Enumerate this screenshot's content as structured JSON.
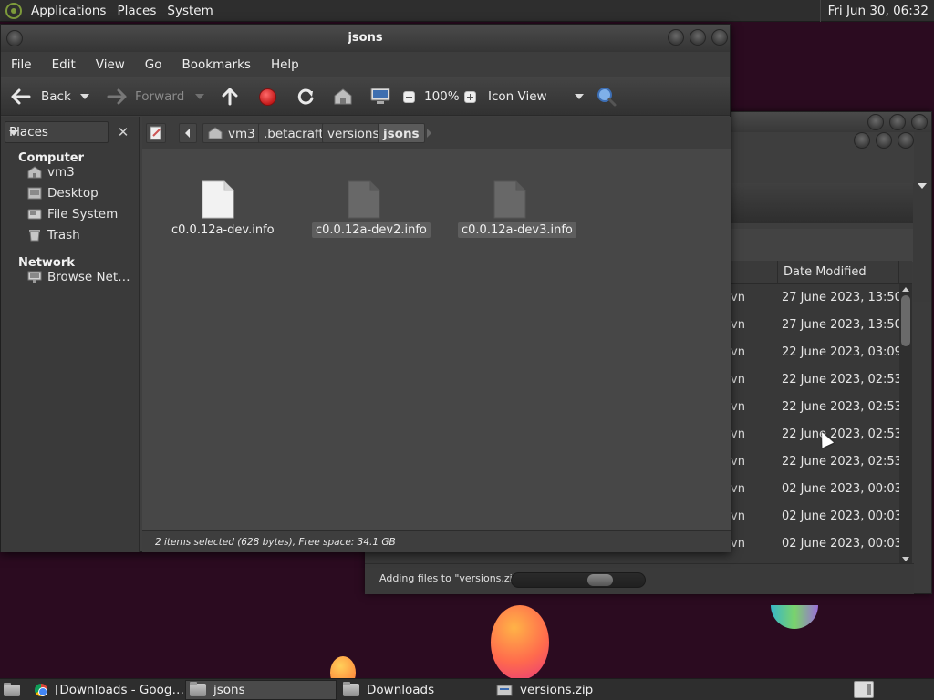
{
  "top_panel": {
    "menus": [
      "Applications",
      "Places",
      "System"
    ],
    "clock": "Fri Jun 30, 06:32"
  },
  "window": {
    "title": "jsons",
    "menus": [
      "File",
      "Edit",
      "View",
      "Go",
      "Bookmarks",
      "Help"
    ],
    "toolbar": {
      "back": "Back",
      "forward": "Forward",
      "zoom": "100%",
      "view_mode": "Icon View"
    },
    "sidebar": {
      "header": "Places",
      "sections": [
        {
          "title": "Computer",
          "items": [
            {
              "label": "vm3",
              "icon": "home-icon"
            },
            {
              "label": "Desktop",
              "icon": "desktop-icon"
            },
            {
              "label": "File System",
              "icon": "drive-icon"
            },
            {
              "label": "Trash",
              "icon": "trash-icon"
            }
          ]
        },
        {
          "title": "Network",
          "items": [
            {
              "label": "Browse Net…",
              "icon": "network-icon"
            }
          ]
        }
      ]
    },
    "breadcrumbs": [
      "vm3",
      ".betacraft",
      "versions",
      "jsons"
    ],
    "files": [
      {
        "name": "c0.0.12a-dev.info",
        "selected": false
      },
      {
        "name": "c0.0.12a-dev2.info",
        "selected": true
      },
      {
        "name": "c0.0.12a-dev3.info",
        "selected": true
      }
    ],
    "status": "2 items selected (628 bytes), Free space: 34.1 GB"
  },
  "back_window": {
    "column_header": "Date Modified",
    "rows": [
      {
        "cut": "vn",
        "date": "27 June 2023, 13:50"
      },
      {
        "cut": "vn",
        "date": "27 June 2023, 13:50"
      },
      {
        "cut": "vn",
        "date": "22 June 2023, 03:09"
      },
      {
        "cut": "vn",
        "date": "22 June 2023, 02:53"
      },
      {
        "cut": "vn",
        "date": "22 June 2023, 02:53"
      },
      {
        "cut": "vn",
        "date": "22 June 2023, 02:53"
      },
      {
        "cut": "vn",
        "date": "22 June 2023, 02:53"
      },
      {
        "cut": "vn",
        "date": "02 June 2023, 00:03"
      },
      {
        "cut": "vn",
        "date": "02 June 2023, 00:03"
      },
      {
        "cut": "vn",
        "date": "02 June 2023, 00:03"
      }
    ],
    "progress": {
      "label": "Adding files to \"versions.zip\"",
      "value": 0.7
    }
  },
  "taskbar": {
    "tasks": [
      {
        "label": "[Downloads - Goog…",
        "icon": "chrome-icon",
        "active": false
      },
      {
        "label": "jsons",
        "icon": "folder-icon",
        "active": true
      },
      {
        "label": "Downloads",
        "icon": "folder-icon",
        "active": false
      },
      {
        "label": "versions.zip",
        "icon": "archive-icon",
        "active": false
      }
    ]
  },
  "colors": {
    "panel": "#2e2e2e",
    "window": "#3f3f3f",
    "content": "#474747",
    "desktop": "#2b0b20",
    "stop_red": "#c41a1a"
  }
}
